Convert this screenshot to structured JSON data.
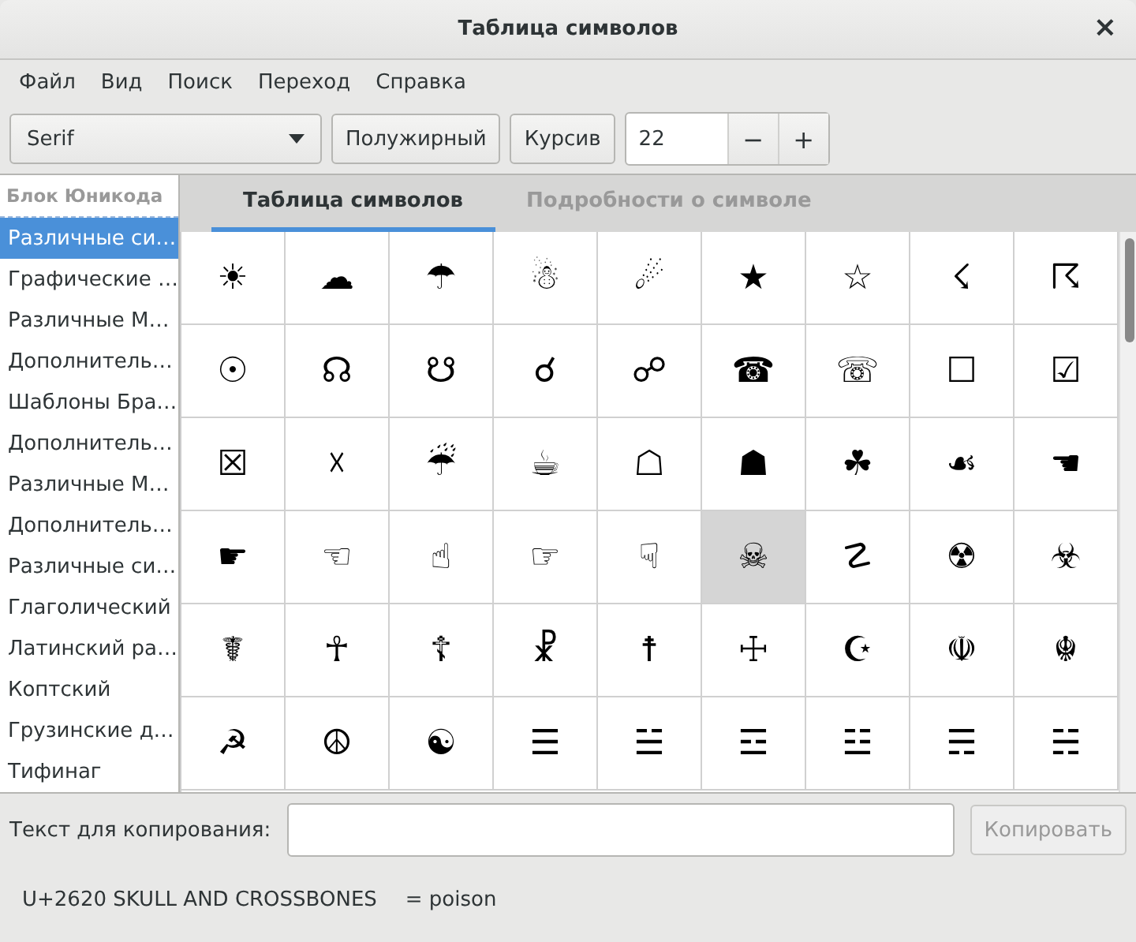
{
  "window": {
    "title": "Таблица символов",
    "close": "×"
  },
  "menu": [
    "Файл",
    "Вид",
    "Поиск",
    "Переход",
    "Справка"
  ],
  "toolbar": {
    "font": "Serif",
    "bold": "Полужирный",
    "italic": "Курсив",
    "size": "22",
    "minus": "−",
    "plus": "+"
  },
  "sidebar": {
    "header": "Блок Юникода",
    "items": [
      {
        "label": "Различные си…",
        "selected": true
      },
      {
        "label": "Графические …",
        "selected": false
      },
      {
        "label": "Различные М…",
        "selected": false
      },
      {
        "label": "Дополнитель…",
        "selected": false
      },
      {
        "label": "Шаблоны Бра…",
        "selected": false
      },
      {
        "label": "Дополнитель…",
        "selected": false
      },
      {
        "label": "Различные М…",
        "selected": false
      },
      {
        "label": "Дополнитель…",
        "selected": false
      },
      {
        "label": "Различные си…",
        "selected": false
      },
      {
        "label": "Глаголический",
        "selected": false
      },
      {
        "label": "Латинский ра…",
        "selected": false
      },
      {
        "label": "Коптский",
        "selected": false
      },
      {
        "label": "Грузинские д…",
        "selected": false
      },
      {
        "label": "Тифинаг",
        "selected": false
      }
    ]
  },
  "tabs": [
    {
      "label": "Таблица символов",
      "selected": true
    },
    {
      "label": "Подробности о символе",
      "selected": false
    }
  ],
  "grid": {
    "cells": [
      {
        "char": "☀",
        "selected": false
      },
      {
        "char": "☁",
        "selected": false
      },
      {
        "char": "☂",
        "selected": false
      },
      {
        "char": "☃",
        "selected": false
      },
      {
        "char": "☄",
        "selected": false
      },
      {
        "char": "★",
        "selected": false
      },
      {
        "char": "☆",
        "selected": false
      },
      {
        "char": "☇",
        "selected": false
      },
      {
        "char": "☈",
        "selected": false
      },
      {
        "char": "☉",
        "selected": false
      },
      {
        "char": "☊",
        "selected": false
      },
      {
        "char": "☋",
        "selected": false
      },
      {
        "char": "☌",
        "selected": false
      },
      {
        "char": "☍",
        "selected": false
      },
      {
        "char": "☎",
        "selected": false
      },
      {
        "char": "☏",
        "selected": false
      },
      {
        "char": "☐",
        "selected": false
      },
      {
        "char": "☑",
        "selected": false
      },
      {
        "char": "☒",
        "selected": false
      },
      {
        "char": "☓",
        "selected": false
      },
      {
        "char": "☔",
        "selected": false
      },
      {
        "char": "☕",
        "selected": false
      },
      {
        "char": "☖",
        "selected": false
      },
      {
        "char": "☗",
        "selected": false
      },
      {
        "char": "☘",
        "selected": false
      },
      {
        "char": "☙",
        "selected": false
      },
      {
        "char": "☚",
        "selected": false
      },
      {
        "char": "☛",
        "selected": false
      },
      {
        "char": "☜",
        "selected": false
      },
      {
        "char": "☝",
        "selected": false
      },
      {
        "char": "☞",
        "selected": false
      },
      {
        "char": "☟",
        "selected": false
      },
      {
        "char": "☠",
        "selected": true
      },
      {
        "char": "☡",
        "selected": false
      },
      {
        "char": "☢",
        "selected": false
      },
      {
        "char": "☣",
        "selected": false
      },
      {
        "char": "☤",
        "selected": false
      },
      {
        "char": "☥",
        "selected": false
      },
      {
        "char": "☦",
        "selected": false
      },
      {
        "char": "☧",
        "selected": false
      },
      {
        "char": "☨",
        "selected": false
      },
      {
        "char": "☩",
        "selected": false
      },
      {
        "char": "☪",
        "selected": false
      },
      {
        "char": "☫",
        "selected": false
      },
      {
        "char": "☬",
        "selected": false
      },
      {
        "char": "☭",
        "selected": false
      },
      {
        "char": "☮",
        "selected": false
      },
      {
        "char": "☯",
        "selected": false
      },
      {
        "char": "☰",
        "selected": false
      },
      {
        "char": "☱",
        "selected": false
      },
      {
        "char": "☲",
        "selected": false
      },
      {
        "char": "☳",
        "selected": false
      },
      {
        "char": "☴",
        "selected": false
      },
      {
        "char": "☵",
        "selected": false
      }
    ]
  },
  "copy": {
    "label": "Текст для копирования:",
    "button": "Копировать",
    "button_disabled": true
  },
  "status": {
    "code": "U+2620 SKULL AND CROSSBONES",
    "note": "= poison"
  }
}
